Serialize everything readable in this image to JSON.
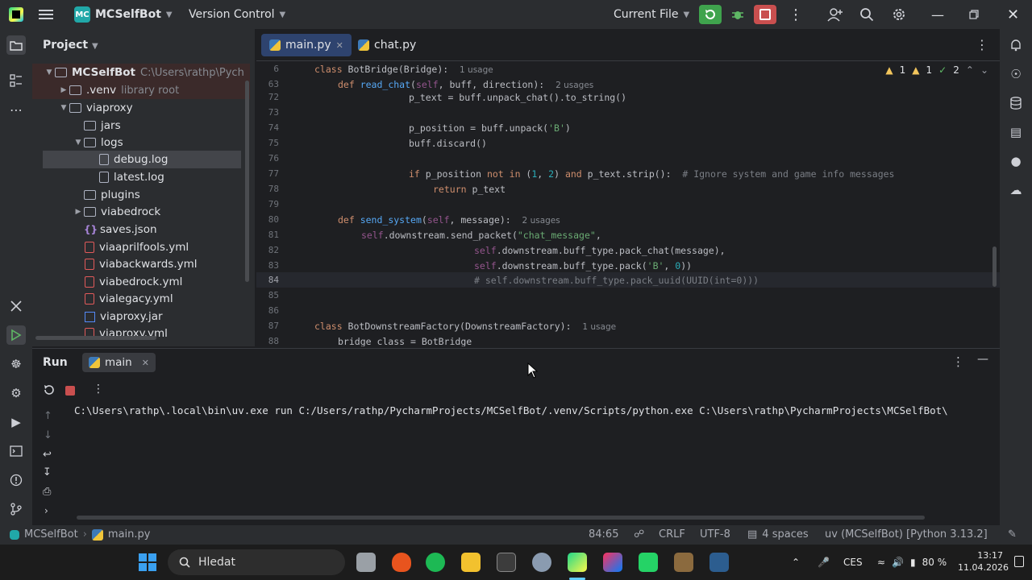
{
  "titlebar": {
    "project_badge": "MC",
    "project_name": "MCSelfBot",
    "vcs": "Version Control",
    "run_config": "Current File"
  },
  "project_panel": {
    "title": "Project",
    "items": [
      {
        "label": "MCSelfBot",
        "extra": "C:\\Users\\rathp\\Pych"
      },
      {
        "label": ".venv",
        "extra": "library root"
      },
      {
        "label": "viaproxy"
      },
      {
        "label": "jars"
      },
      {
        "label": "logs"
      },
      {
        "label": "debug.log"
      },
      {
        "label": "latest.log"
      },
      {
        "label": "plugins"
      },
      {
        "label": "viabedrock"
      },
      {
        "label": "saves.json"
      },
      {
        "label": "viaaprilfools.yml"
      },
      {
        "label": "viabackwards.yml"
      },
      {
        "label": "viabedrock.yml"
      },
      {
        "label": "vialegacy.yml"
      },
      {
        "label": "viaproxy.jar"
      },
      {
        "label": "viaproxy.yml"
      }
    ]
  },
  "editor": {
    "tabs": [
      {
        "label": "main.py"
      },
      {
        "label": "chat.py"
      }
    ],
    "inspections": {
      "warnings": "1",
      "weak": "1",
      "typos": "2"
    },
    "line_numbers": [
      "6",
      "63",
      "72",
      "73",
      "74",
      "75",
      "76",
      "77",
      "78",
      "79",
      "80",
      "81",
      "82",
      "83",
      "84",
      "85",
      "86",
      "87",
      "88"
    ],
    "usages": {
      "l6": "1 usage",
      "l63": "2 usages",
      "l80": "2 usages",
      "l87": "1 usage"
    },
    "code": {
      "l6_a": "class ",
      "l6_b": "BotBridge",
      "l6_c": "(Bridge):",
      "l63_a": "def ",
      "l63_b": "read_chat",
      "l63_c": "(",
      "l63_d": "self",
      "l63_e": ", buff, direction):",
      "l72": "p_text = buff.unpack_chat().to_string()",
      "l74_a": "p_position = buff.unpack(",
      "l74_b": "'B'",
      "l74_c": ")",
      "l75": "buff.discard()",
      "l77_a": "if ",
      "l77_b": "p_position ",
      "l77_c": "not in ",
      "l77_d": "(",
      "l77_e": "1",
      "l77_f": ", ",
      "l77_g": "2",
      "l77_h": ") ",
      "l77_i": "and ",
      "l77_j": "p_text.strip():",
      "l77_k": "  # Ignore system and game info messages",
      "l78_a": "return ",
      "l78_b": "p_text",
      "l80_a": "def ",
      "l80_b": "send_system",
      "l80_c": "(",
      "l80_d": "self",
      "l80_e": ", message):",
      "l81_a": "self",
      "l81_b": ".downstream.send_packet(",
      "l81_c": "\"chat_message\"",
      "l81_d": ",",
      "l82_a": "self",
      "l82_b": ".downstream.buff_type.pack_chat(message),",
      "l83_a": "self",
      "l83_b": ".downstream.buff_type.pack(",
      "l83_c": "'B'",
      "l83_d": ", ",
      "l83_e": "0",
      "l83_f": "))",
      "l84": "# self.downstream.buff_type.pack_uuid(UUID(int=0)))",
      "l87_a": "class ",
      "l87_b": "BotDownstreamFactory",
      "l87_c": "(DownstreamFactory):",
      "l88": "bridge_class = BotBridge"
    }
  },
  "run_panel": {
    "title": "Run",
    "tab": "main",
    "console": "C:\\Users\\rathp\\.local\\bin\\uv.exe run C:/Users/rathp/PycharmProjects/MCSelfBot/.venv/Scripts/python.exe C:\\Users\\rathp\\PycharmProjects\\MCSelfBot\\"
  },
  "statusbar": {
    "breadcrumb_project": "MCSelfBot",
    "breadcrumb_file": "main.py",
    "position": "84:65",
    "line_sep": "CRLF",
    "encoding": "UTF-8",
    "indent": "4 spaces",
    "interpreter": "uv (MCSelfBot) [Python 3.13.2]"
  },
  "taskbar": {
    "search_placeholder": "Hledat",
    "lang": "CES",
    "battery": "80 %",
    "time": "13:17",
    "date": "11.04.2026"
  },
  "colors": {
    "keyword": "#cf8e6d",
    "function": "#56a8f5",
    "self": "#94558d",
    "string": "#6aab73",
    "number": "#2aacb8",
    "comment": "#7a7e85",
    "run_green": "#3fa34d",
    "stop_red": "#c94f4f"
  }
}
